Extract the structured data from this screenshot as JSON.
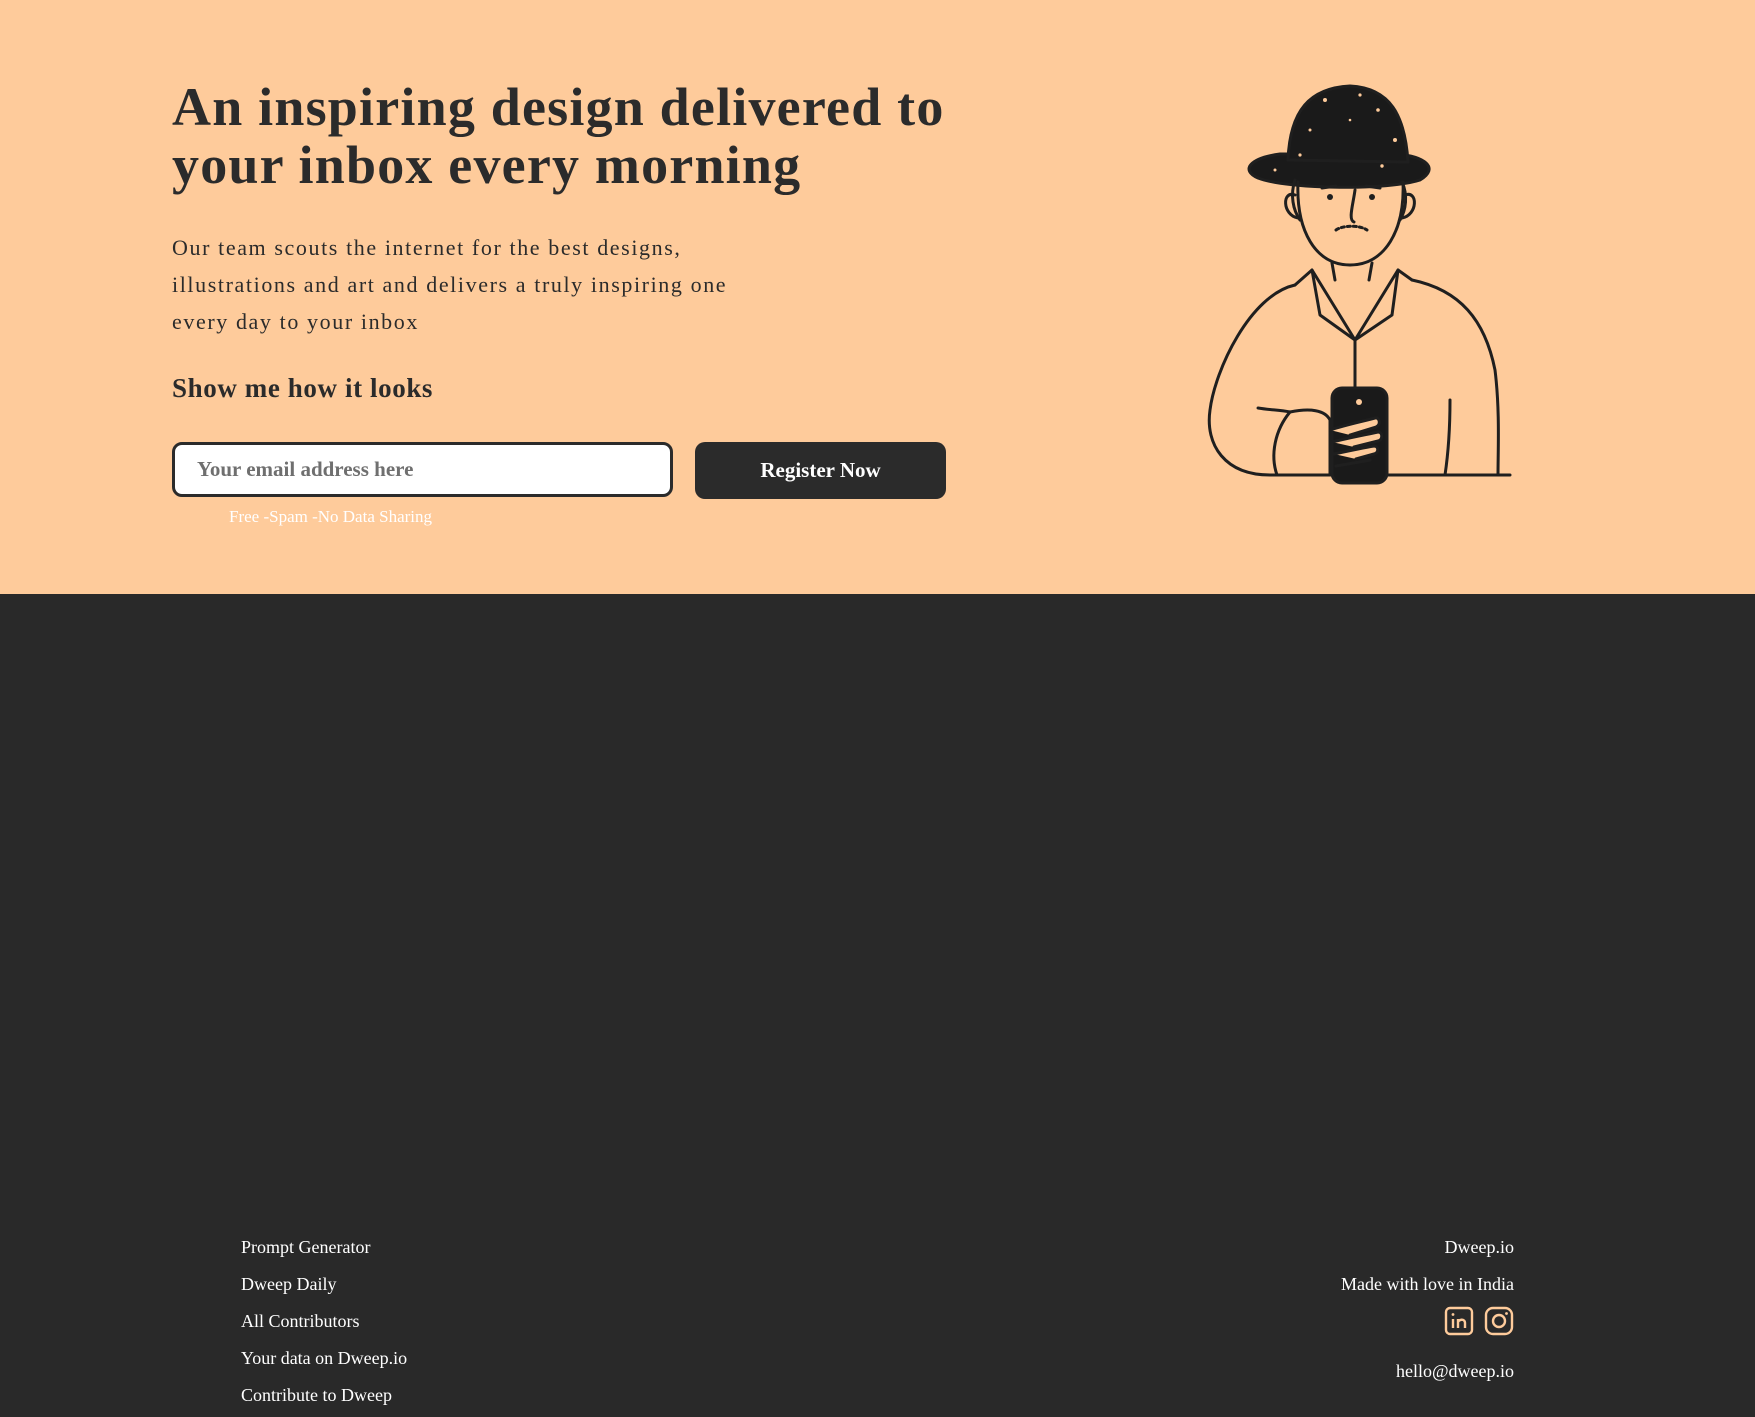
{
  "hero": {
    "headline": "An inspiring design delivered to your inbox every morning",
    "subtext": "Our team scouts the internet for the best designs, illustrations and art and delivers a truly inspiring one every day to your inbox",
    "section_heading": "Show me how it looks",
    "email_placeholder": "Your email address here",
    "register_label": "Register Now",
    "no_spam_note": "Free -Spam -No Data Sharing",
    "illustration_icon": "man-with-hat-holding-phone-illustration"
  },
  "footer": {
    "links": [
      "Prompt Generator",
      "Dweep Daily",
      "All Contributors",
      "Your data on Dweep.io",
      "Contribute to Dweep"
    ],
    "brand": "Dweep.io",
    "tagline": "Made with love in India",
    "social_icons": [
      "linkedin-icon",
      "instagram-icon"
    ],
    "contact_email": "hello@dweep.io"
  },
  "colors": {
    "hero_background": "#FECB9B",
    "footer_background": "#292929",
    "text_dark": "#2B2B2B",
    "button_background": "#2B2B2B",
    "social_icon_color": "#FECB9B"
  }
}
